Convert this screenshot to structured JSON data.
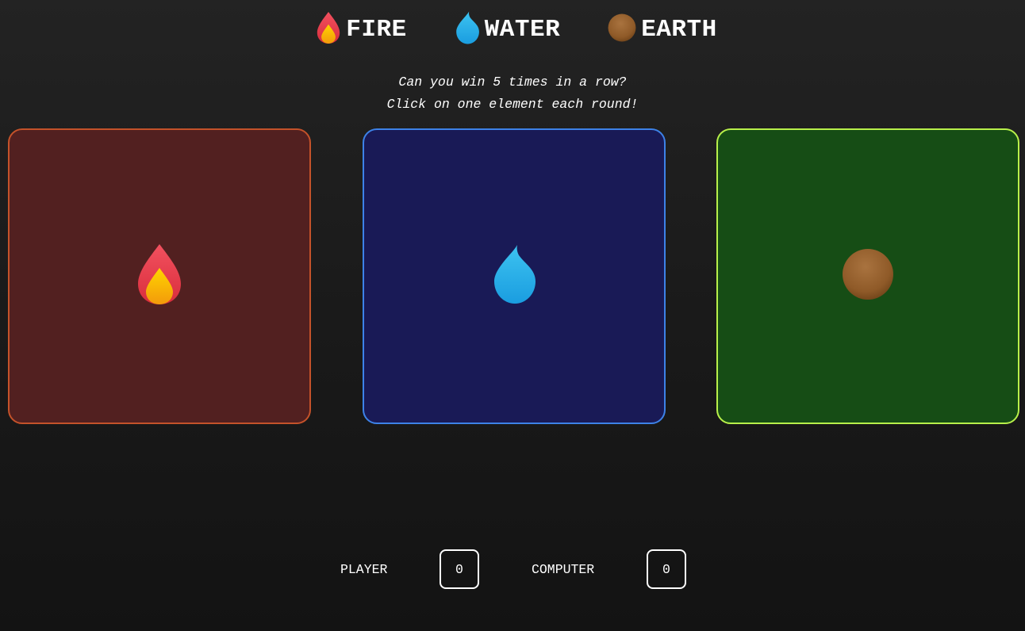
{
  "header": {
    "items": [
      {
        "label": "FIRE",
        "icon": "fire-icon"
      },
      {
        "label": "WATER",
        "icon": "water-drop-icon"
      },
      {
        "label": "EARTH",
        "icon": "earth-ball-icon"
      }
    ]
  },
  "instructions": {
    "line1": "Can you win 5 times in a row?",
    "line2": "Click on one element each round!"
  },
  "cards": [
    {
      "element": "fire",
      "icon": "fire-icon",
      "background": "#522020",
      "border": "#c4522a"
    },
    {
      "element": "water",
      "icon": "water-drop-icon",
      "background": "#191a56",
      "border": "#3d82e8"
    },
    {
      "element": "earth",
      "icon": "earth-ball-icon",
      "background": "#164d15",
      "border": "#b8f04a"
    }
  ],
  "scoreboard": {
    "player_label": "PLAYER",
    "player_score": "0",
    "computer_label": "COMPUTER",
    "computer_score": "0"
  }
}
